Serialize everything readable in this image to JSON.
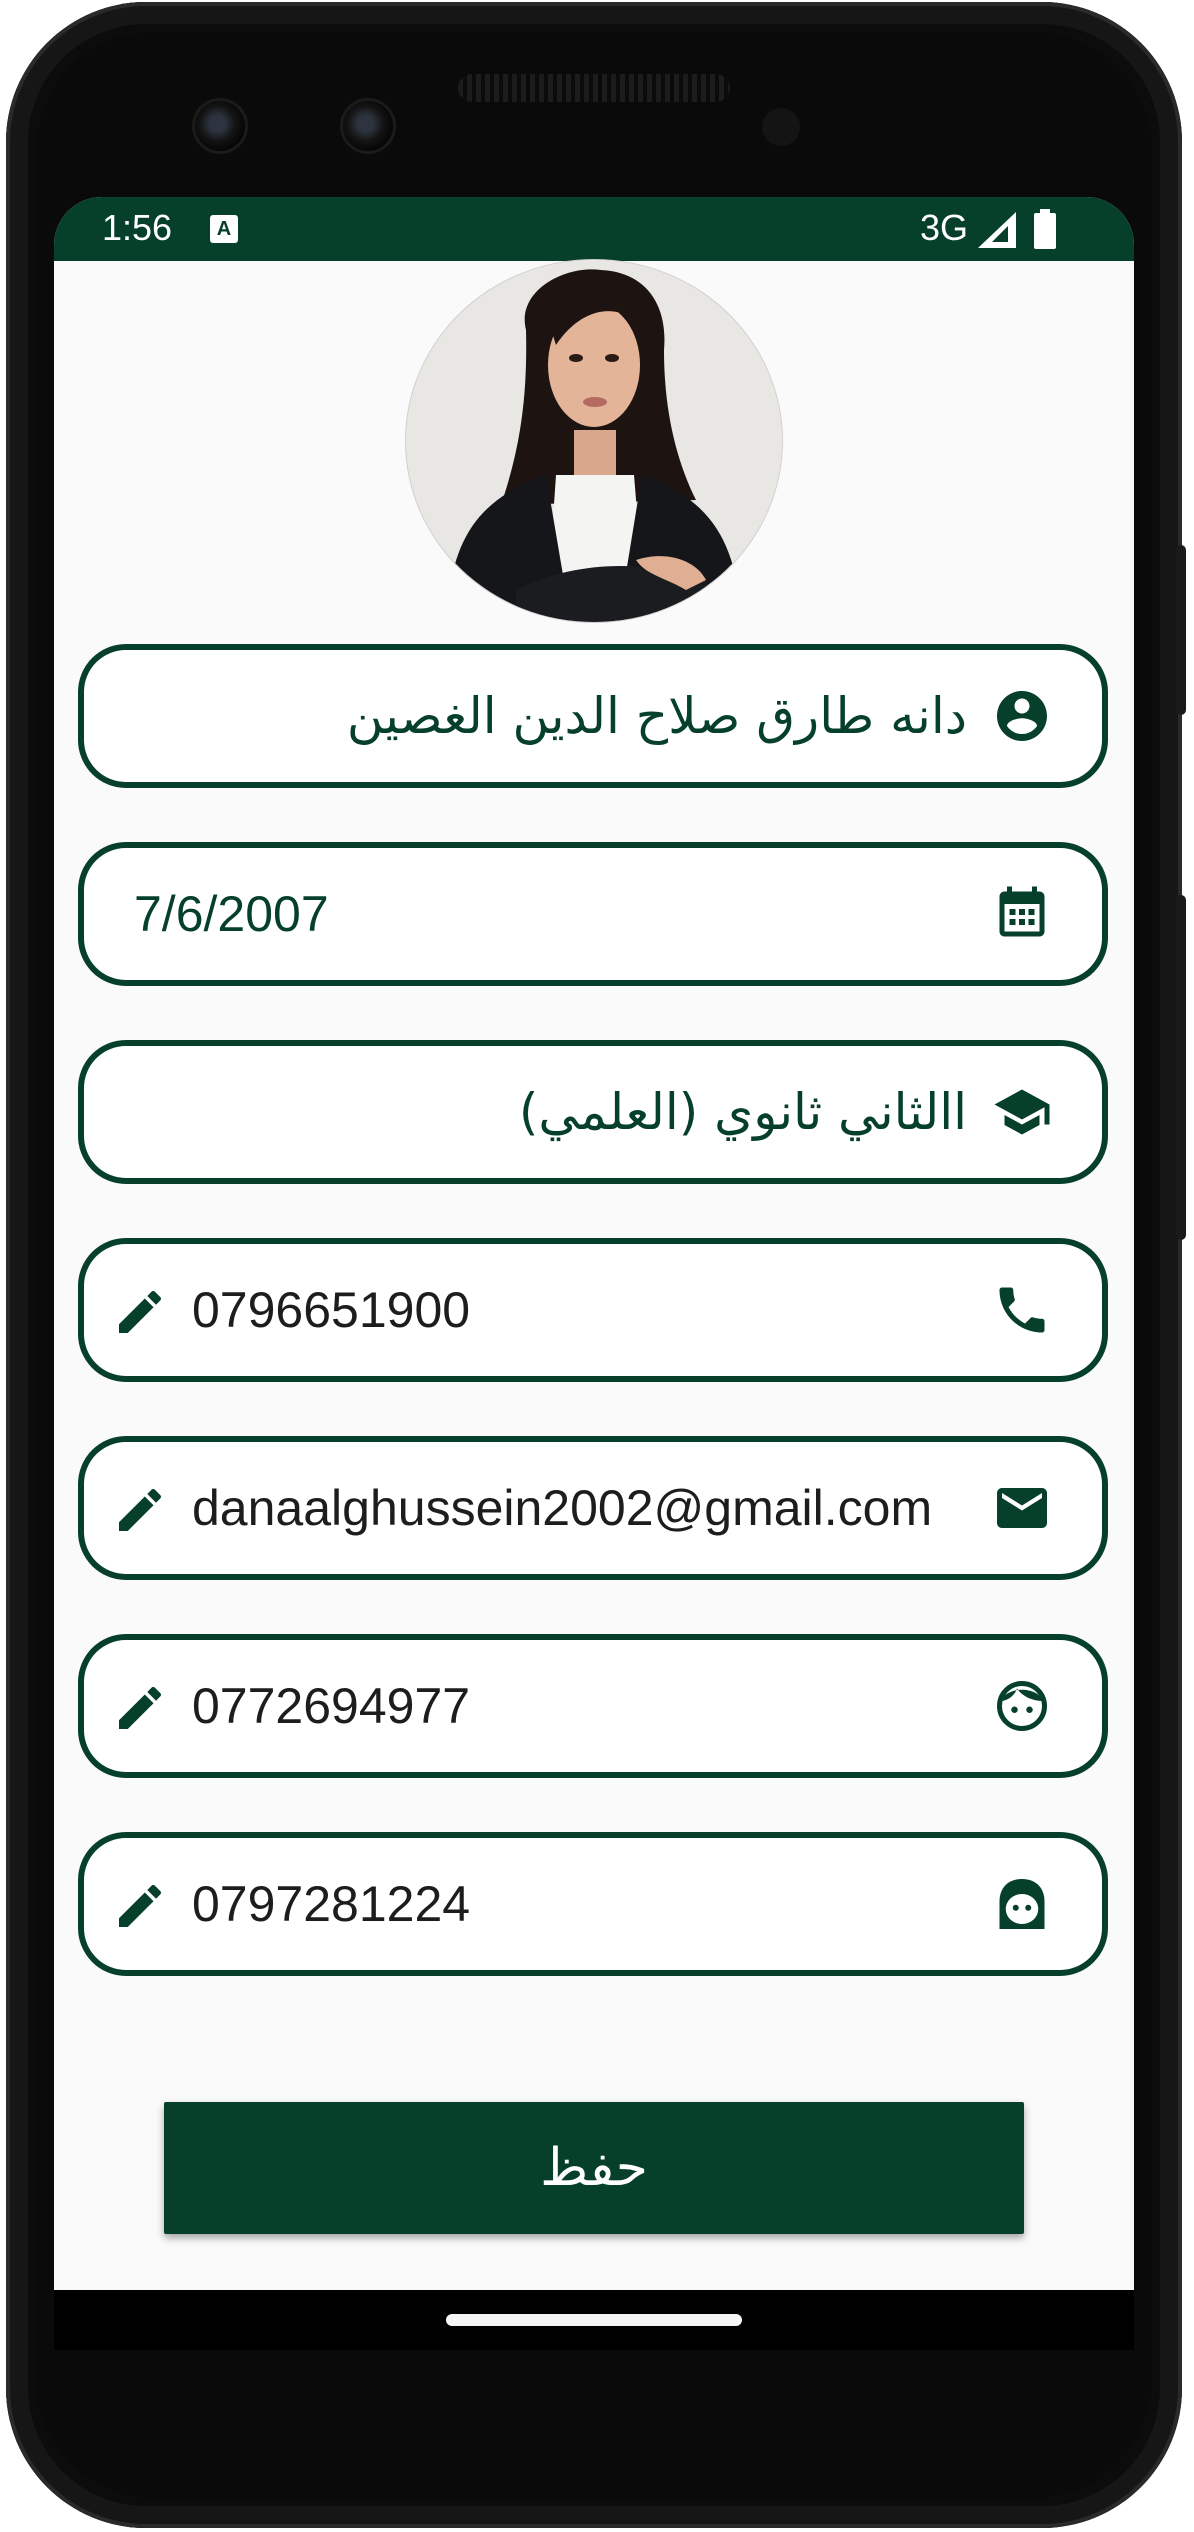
{
  "status_bar": {
    "time": "1:56",
    "notification_icon": "A",
    "network": "3G",
    "signal_icon": "cell-signal-icon",
    "battery_icon": "battery-icon"
  },
  "theme": {
    "primary": "#06402b",
    "background": "#fafafa",
    "text_dark": "#1d1d1d"
  },
  "profile": {
    "avatar_icon": "profile-photo"
  },
  "fields": {
    "name": {
      "value": "دانه طارق صلاح الدين الغصين",
      "icon": "account-circle-icon"
    },
    "birth_date": {
      "value": "7/6/2007",
      "icon": "calendar-icon"
    },
    "grade": {
      "value": "االثاني ثانوي (العلمي)",
      "icon": "graduation-cap-icon"
    },
    "phone": {
      "value": "0796651900",
      "icon": "phone-icon",
      "edit_icon": "pencil-icon"
    },
    "email": {
      "value": "danaalghussein2002@gmail.com",
      "icon": "envelope-icon",
      "edit_icon": "pencil-icon"
    },
    "father_phone": {
      "value": "0772694977",
      "icon": "boy-face-icon",
      "edit_icon": "pencil-icon"
    },
    "mother_phone": {
      "value": "0797281224",
      "icon": "girl-face-icon",
      "edit_icon": "pencil-icon"
    }
  },
  "actions": {
    "save_label": "حفظ"
  }
}
